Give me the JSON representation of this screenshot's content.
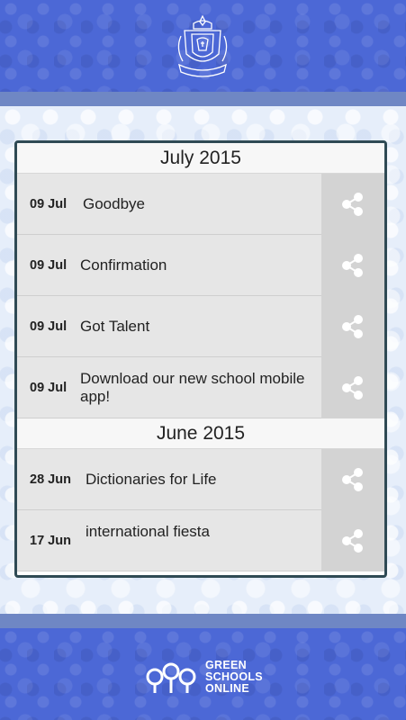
{
  "header": {
    "crest_icon": "school-crest-icon"
  },
  "sections": [
    {
      "month": "July 2015",
      "items": [
        {
          "date": "09 Jul",
          "title": "Goodbye"
        },
        {
          "date": "09 Jul",
          "title": "Confirmation"
        },
        {
          "date": "09 Jul",
          "title": "Got Talent"
        },
        {
          "date": "09 Jul",
          "title": "Download our new school mobile app!"
        }
      ]
    },
    {
      "month": "June 2015",
      "items": [
        {
          "date": "28 Jun",
          "title": "Dictionaries for Life"
        },
        {
          "date": "17 Jun",
          "title": "international fiesta"
        }
      ]
    }
  ],
  "footer": {
    "logo_line1": "GREEN",
    "logo_line2": "SCHOOLS",
    "logo_line3": "ONLINE",
    "logo_icon": "green-schools-online-logo-icon"
  },
  "colors": {
    "header_bg": "#4c68d6",
    "band": "#6f87c4",
    "panel_border": "#2f4a54",
    "row_bg": "#e6e6e6",
    "share_bg": "#d3d3d3"
  }
}
